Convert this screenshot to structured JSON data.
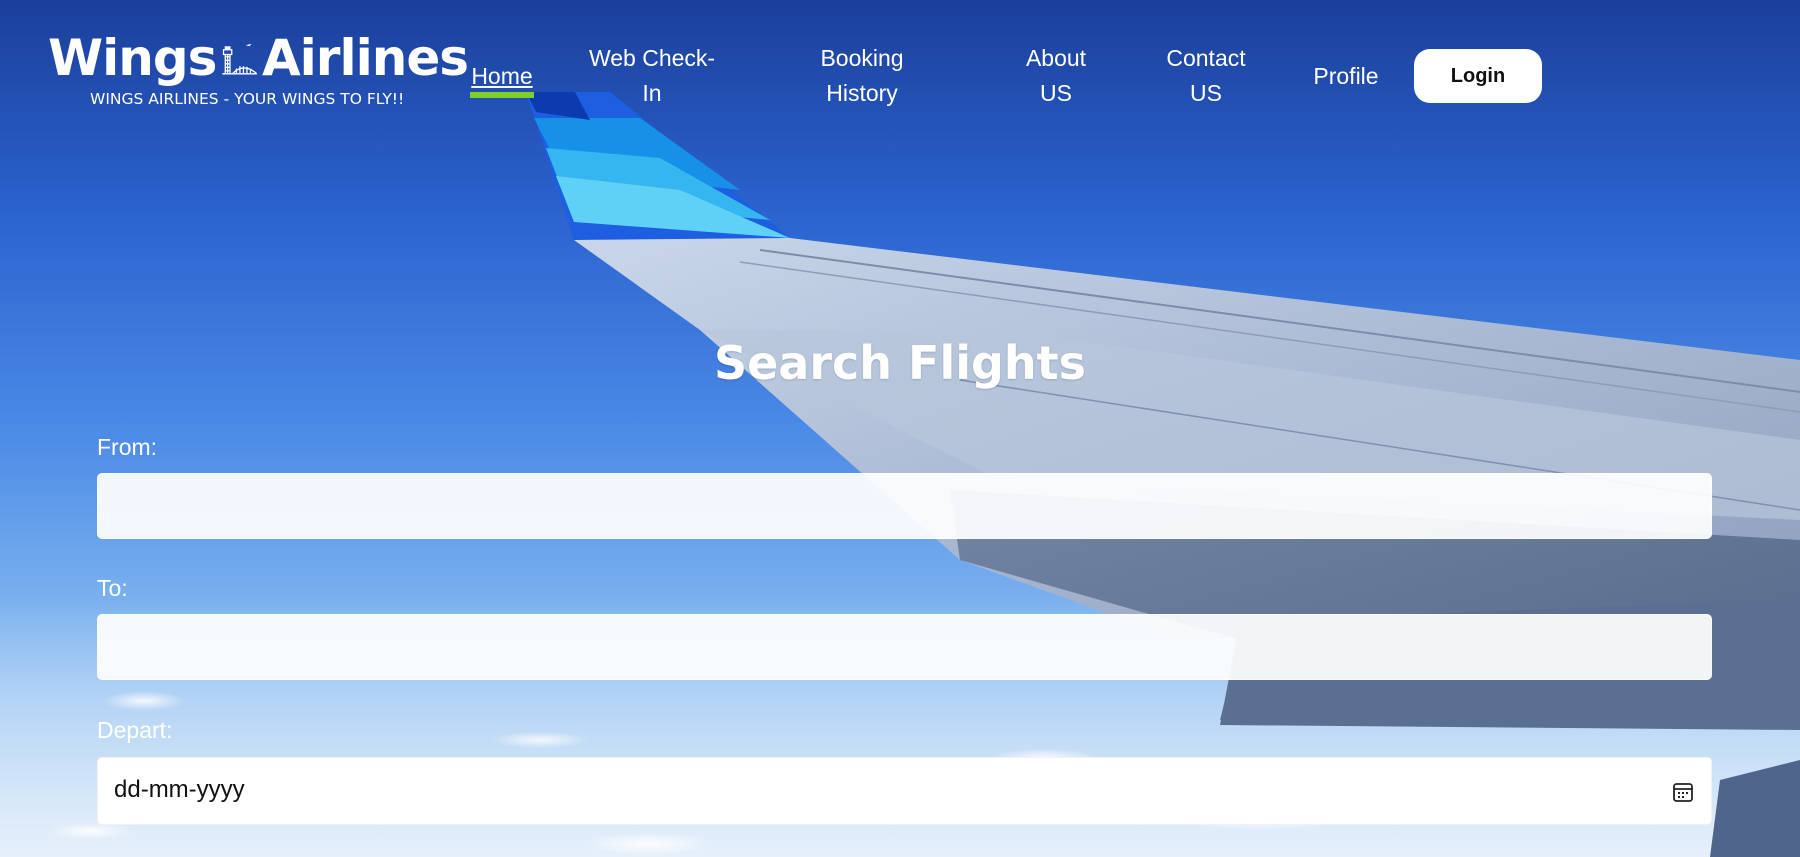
{
  "brand": {
    "name_part1": "Wings",
    "name_part2": "Airlines",
    "tagline": "WINGS AIRLINES - YOUR WINGS TO FLY!!",
    "logo_icon": "control-tower-icon"
  },
  "nav": {
    "home": "Home",
    "web_checkin_line1": "Web Check-",
    "web_checkin_line2": "In",
    "booking_line1": "Booking",
    "booking_line2": "History",
    "about_line1": "About",
    "about_line2": "US",
    "contact_line1": "Contact",
    "contact_line2": "US",
    "profile": "Profile",
    "login": "Login",
    "active_item": "Home",
    "active_underline_color": "#7fcf2a"
  },
  "search": {
    "title": "Search Flights",
    "from_label": "From:",
    "from_value": "",
    "to_label": "To:",
    "to_value": "",
    "depart_label": "Depart:",
    "depart_placeholder": "dd-mm-yyyy",
    "calendar_icon": "calendar-icon"
  },
  "colors": {
    "sky_top": "#1b3f9a",
    "sky_bottom": "#cfe2f6",
    "text": "#ffffff"
  }
}
